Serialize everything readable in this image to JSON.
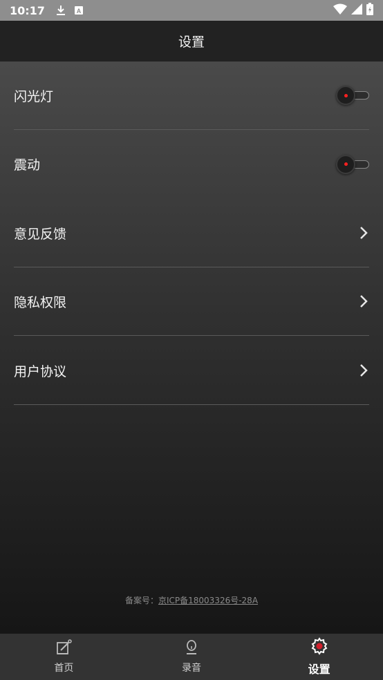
{
  "status_bar": {
    "time": "10:17",
    "icons": [
      "download-icon",
      "a-notification-icon",
      "wifi-icon",
      "signal-icon",
      "battery-icon"
    ]
  },
  "header": {
    "title": "设置"
  },
  "settings": {
    "items": [
      {
        "label": "闪光灯",
        "control": "toggle",
        "on": false
      },
      {
        "label": "震动",
        "control": "toggle",
        "on": false
      },
      {
        "label": "意见反馈",
        "control": "chevron"
      },
      {
        "label": "隐私权限",
        "control": "chevron"
      },
      {
        "label": "用户协议",
        "control": "chevron"
      }
    ]
  },
  "footer": {
    "icp_prefix": "备案号：",
    "icp_number": "京ICP备18003326号-28A"
  },
  "tabs": [
    {
      "label": "首页",
      "icon": "edit-note-icon",
      "active": false
    },
    {
      "label": "录音",
      "icon": "microphone-icon",
      "active": false
    },
    {
      "label": "设置",
      "icon": "gear-icon",
      "active": true
    }
  ],
  "colors": {
    "toggle_dot": "#ff2020",
    "tabbar": "#333333",
    "statusbar": "#8e8e8e"
  }
}
